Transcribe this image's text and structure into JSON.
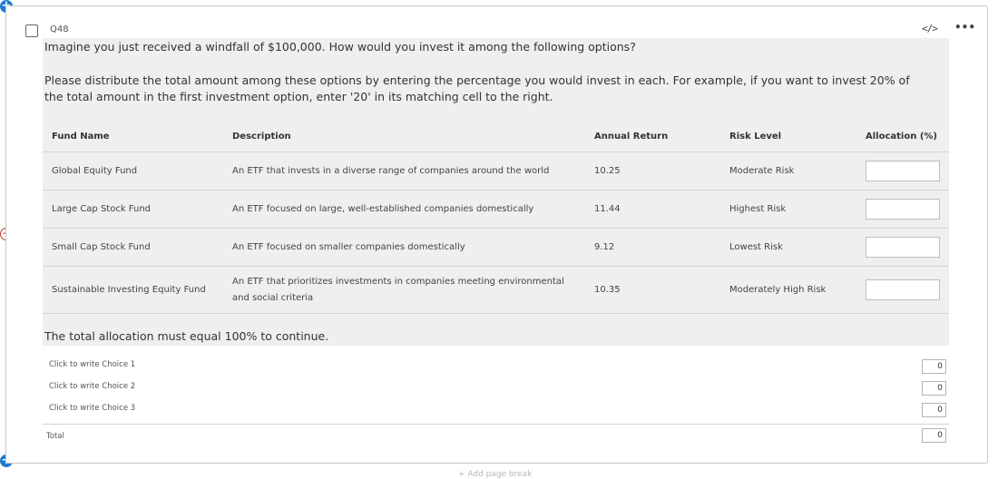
{
  "question": {
    "id": "Q48",
    "prompt": "Imagine you just received a windfall of $100,000. How would you invest it among the following options?",
    "instructions": "Please distribute the total amount among these options by entering the percentage you would invest in each. For example, if you want to invest 20% of the total amount in the first investment option, enter '20' in its matching cell to the right.",
    "footer": "The total allocation must equal 100% to continue."
  },
  "table": {
    "headers": [
      "Fund Name",
      "Description",
      "Annual Return",
      "Risk Level",
      "Allocation (%)"
    ],
    "rows": [
      {
        "fund": "Global Equity Fund",
        "description": "An ETF that invests in a diverse range of companies around the world",
        "return": "10.25",
        "risk": "Moderate Risk"
      },
      {
        "fund": "Large Cap Stock Fund",
        "description": "An ETF focused on large, well-established companies domestically",
        "return": "11.44",
        "risk": "Highest Risk"
      },
      {
        "fund": "Small Cap Stock Fund",
        "description": "An ETF focused on smaller companies domestically",
        "return": "9.12",
        "risk": "Lowest Risk"
      },
      {
        "fund": "Sustainable Investing Equity Fund",
        "description": "An ETF that prioritizes investments in companies meeting environmental and social criteria",
        "return": "10.35",
        "risk": "Moderately High Risk"
      }
    ]
  },
  "choices": [
    {
      "label": "Click to write Choice 1",
      "value": "0"
    },
    {
      "label": "Click to write Choice 2",
      "value": "0"
    },
    {
      "label": "Click to write Choice 3",
      "value": "0"
    }
  ],
  "total": {
    "label": "Total",
    "value": "0"
  },
  "toolbar": {
    "code_icon": "</>",
    "more_icon": "•••"
  },
  "add_page_break": "+ Add page break"
}
